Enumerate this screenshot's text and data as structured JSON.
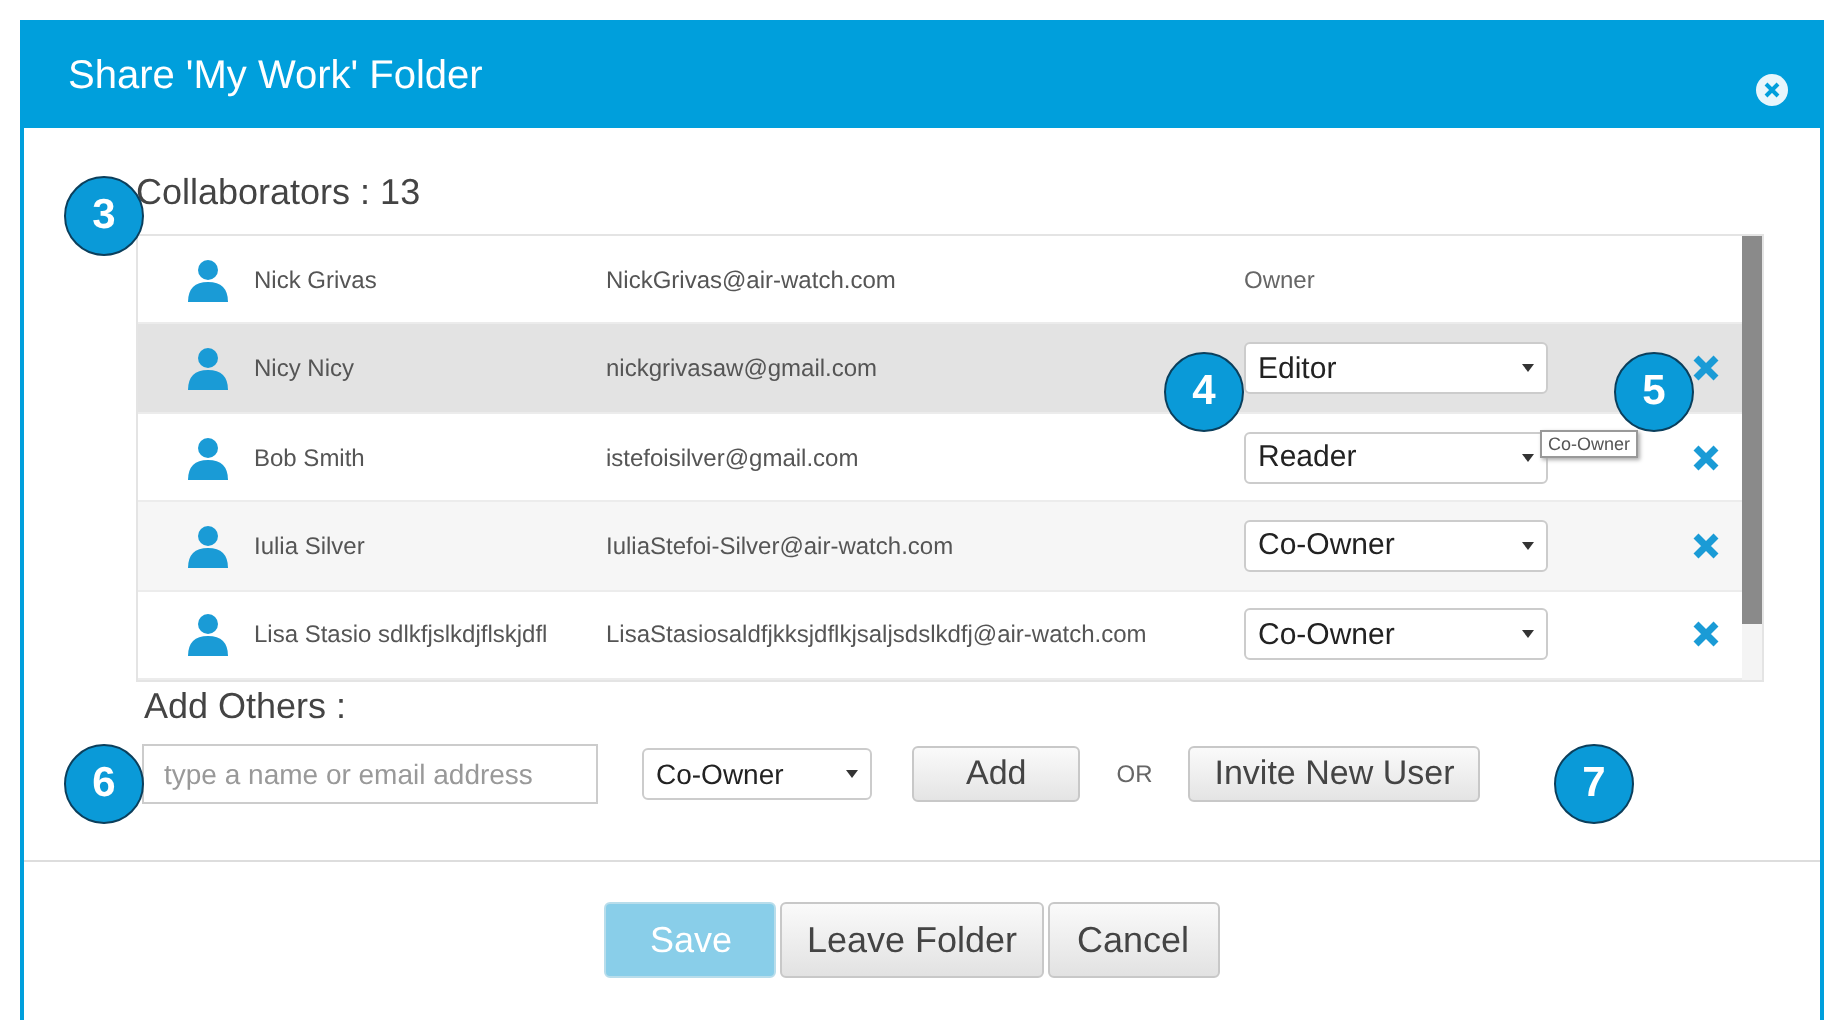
{
  "dialog": {
    "title": "Share 'My Work' Folder"
  },
  "collaborators": {
    "label": "Collaborators : 13"
  },
  "rows": [
    {
      "name": "Nick Grivas",
      "email": "NickGrivas@air-watch.com",
      "role": "Owner",
      "kind": "text",
      "selected": false
    },
    {
      "name": "Nicy Nicy",
      "email": "nickgrivasaw@gmail.com",
      "role": "Editor",
      "kind": "select",
      "selected": true
    },
    {
      "name": "Bob Smith",
      "email": "istefoisilver@gmail.com",
      "role": "Reader",
      "kind": "select",
      "selected": false
    },
    {
      "name": "Iulia Silver",
      "email": "IuliaStefoi-Silver@air-watch.com",
      "role": "Co-Owner",
      "kind": "select",
      "selected": false
    },
    {
      "name": "Lisa Stasio sdlkfjslkdjflskjdfl",
      "email": "LisaStasiosaldfjkksjdflkjsaljsdslkdfj@air-watch.com",
      "role": "Co-Owner",
      "kind": "select",
      "selected": false
    }
  ],
  "tooltip": "Co-Owner",
  "add_others": {
    "label": "Add Others :",
    "placeholder": "type a name or email address",
    "role": "Co-Owner",
    "add": "Add",
    "or": "OR",
    "invite": "Invite New User"
  },
  "buttons": [
    {
      "label": "Save",
      "kind": "primary",
      "disabled": true
    },
    {
      "label": "Leave Folder",
      "kind": "default",
      "disabled": false
    },
    {
      "label": "Cancel",
      "kind": "default",
      "disabled": false
    }
  ],
  "callouts": [
    "3",
    "4",
    "5",
    "6",
    "7"
  ]
}
